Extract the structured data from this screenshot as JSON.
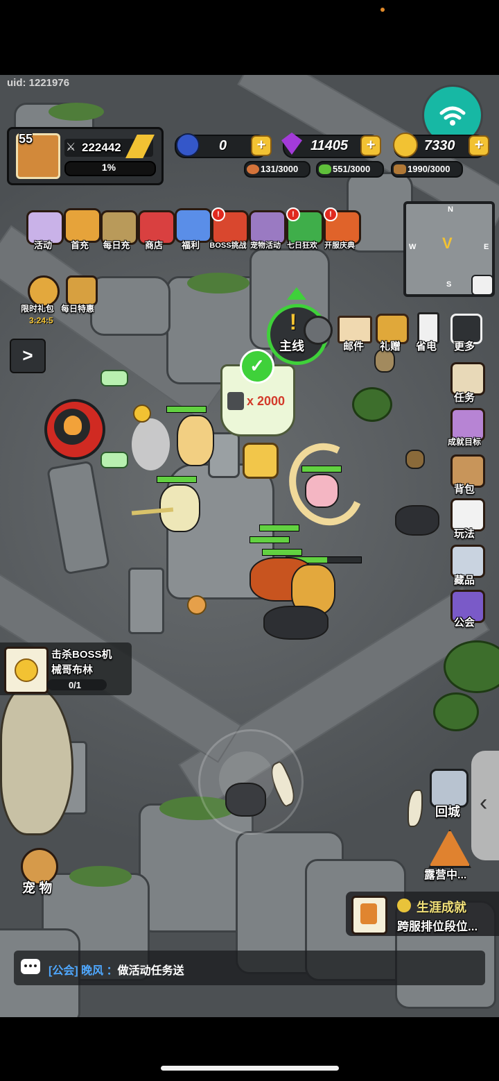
{
  "status": {
    "uid": "uid: 1221976"
  },
  "player": {
    "level": "55",
    "power": "222442",
    "exp_percent": "1%"
  },
  "resources": {
    "moon": "0",
    "gems": "11405",
    "gold": "7330",
    "meat": "131/3000",
    "herb": "551/3000",
    "wood": "1990/3000"
  },
  "top_menu": [
    {
      "label": "活动",
      "icon": "activity-gift-icon"
    },
    {
      "label": "首充",
      "icon": "first-recharge-crown-icon"
    },
    {
      "label": "每日充",
      "icon": "daily-recharge-chest-icon"
    },
    {
      "label": "商店",
      "icon": "shop-icon"
    },
    {
      "label": "福利",
      "icon": "welfare-gift-icon"
    },
    {
      "label": "BOSS挑战",
      "icon": "boss-challenge-icon"
    },
    {
      "label": "宠物活动",
      "icon": "pet-event-icon"
    },
    {
      "label": "七日狂欢",
      "icon": "seven-day-carnival-icon"
    },
    {
      "label": "开服庆典",
      "icon": "server-celebration-icon"
    }
  ],
  "limited": {
    "gift_label": "限时礼包",
    "timer": "3:24:5",
    "daily_label": "每日特惠"
  },
  "right_row": [
    {
      "label": "邮件",
      "icon": "mail-icon"
    },
    {
      "label": "礼赠",
      "icon": "gift-icon"
    },
    {
      "label": "省电",
      "icon": "battery-icon"
    },
    {
      "label": "更多",
      "icon": "more-grid-icon"
    }
  ],
  "main_quest": {
    "label": "主线",
    "reward": "x 2000"
  },
  "side_menu": [
    {
      "label": "任务",
      "icon": "quest-scroll-icon"
    },
    {
      "label": "成就目标",
      "icon": "achievement-icon"
    },
    {
      "label": "背包",
      "icon": "backpack-icon"
    },
    {
      "label": "玩法",
      "icon": "gameplay-icon"
    },
    {
      "label": "藏品",
      "icon": "collection-trophy-icon"
    },
    {
      "label": "公会",
      "icon": "guild-shield-icon"
    }
  ],
  "quest_tracker": {
    "title": "击杀BOSS机",
    "subtitle": "械哥布林",
    "progress": "0/1"
  },
  "bottom": {
    "return_city": "回城",
    "camp": "露营中...",
    "pet": "宠 物",
    "career_title": "生涯成就",
    "career_sub": "跨服排位段位..."
  },
  "chat": {
    "channel": "[公会]",
    "name": "晚风",
    "separator": "：",
    "message": "做活动任务送"
  },
  "minimap": {
    "north": "N",
    "south": "S",
    "east": "E",
    "west": "W"
  },
  "colors": {
    "accent_green": "#3fd13a",
    "gold": "#f2c233",
    "danger_red": "#e02a1f"
  }
}
